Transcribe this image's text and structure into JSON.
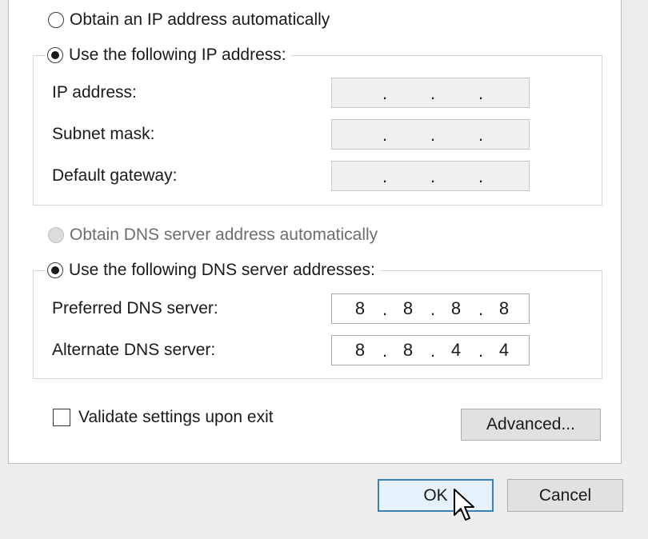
{
  "ip_section": {
    "auto_label": "Obtain an IP address automatically",
    "manual_label": "Use the following IP address:",
    "fields": [
      {
        "label": "IP address:",
        "octets": [
          "",
          "",
          "",
          ""
        ]
      },
      {
        "label": "Subnet mask:",
        "octets": [
          "",
          "",
          "",
          ""
        ]
      },
      {
        "label": "Default gateway:",
        "octets": [
          "",
          "",
          "",
          ""
        ]
      }
    ]
  },
  "dns_section": {
    "auto_label": "Obtain DNS server address automatically",
    "manual_label": "Use the following DNS server addresses:",
    "fields": [
      {
        "label": "Preferred DNS server:",
        "octets": [
          "8",
          "8",
          "8",
          "8"
        ]
      },
      {
        "label": "Alternate DNS server:",
        "octets": [
          "8",
          "8",
          "4",
          "4"
        ]
      }
    ]
  },
  "validate_label": "Validate settings upon exit",
  "buttons": {
    "advanced": "Advanced...",
    "ok": "OK",
    "cancel": "Cancel"
  },
  "icons": {
    "cursor": "mouse-pointer-icon"
  },
  "colors": {
    "default_button_border": "#3c7fb1",
    "default_button_bg": "#e5f1fb"
  }
}
